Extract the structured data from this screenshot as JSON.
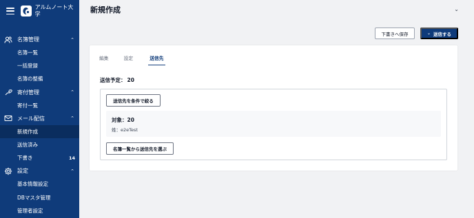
{
  "brand": {
    "name": "アルムノート大学"
  },
  "sidebar": {
    "sections": [
      {
        "label": "名簿管理",
        "icon": "users-icon",
        "items": [
          {
            "label": "名簿一覧"
          },
          {
            "label": "一括登録"
          },
          {
            "label": "名簿の整備"
          }
        ]
      },
      {
        "label": "寄付管理",
        "icon": "hand-heart-icon",
        "items": [
          {
            "label": "寄付一覧"
          }
        ]
      },
      {
        "label": "メール配信",
        "icon": "mail-icon",
        "items": [
          {
            "label": "新規作成"
          },
          {
            "label": "送信済み"
          },
          {
            "label": "下書き",
            "badge": "14"
          }
        ]
      },
      {
        "label": "設定",
        "icon": "gear-icon",
        "items": [
          {
            "label": "基本情報設定"
          },
          {
            "label": "DBマスタ管理"
          },
          {
            "label": "管理者設定"
          }
        ]
      }
    ]
  },
  "header": {
    "title": "新規作成"
  },
  "actions": {
    "save_draft": "下書きへ保存",
    "send": "送信する"
  },
  "tabs": [
    {
      "label": "編集"
    },
    {
      "label": "設定"
    },
    {
      "label": "送信先"
    }
  ],
  "recipients": {
    "planned_label": "送信予定：",
    "planned_count": "20",
    "filter_button": "送信先を条件で絞る",
    "target_title": "対象：20",
    "target_condition": "姓：e2eTest",
    "select_button": "名簿一覧から送信先を選ぶ"
  },
  "colors": {
    "sidebar": "#0f3b7a",
    "sidebar_active": "#0a2d5e",
    "accent": "#0f3b7a",
    "background": "#f1f2f4"
  }
}
